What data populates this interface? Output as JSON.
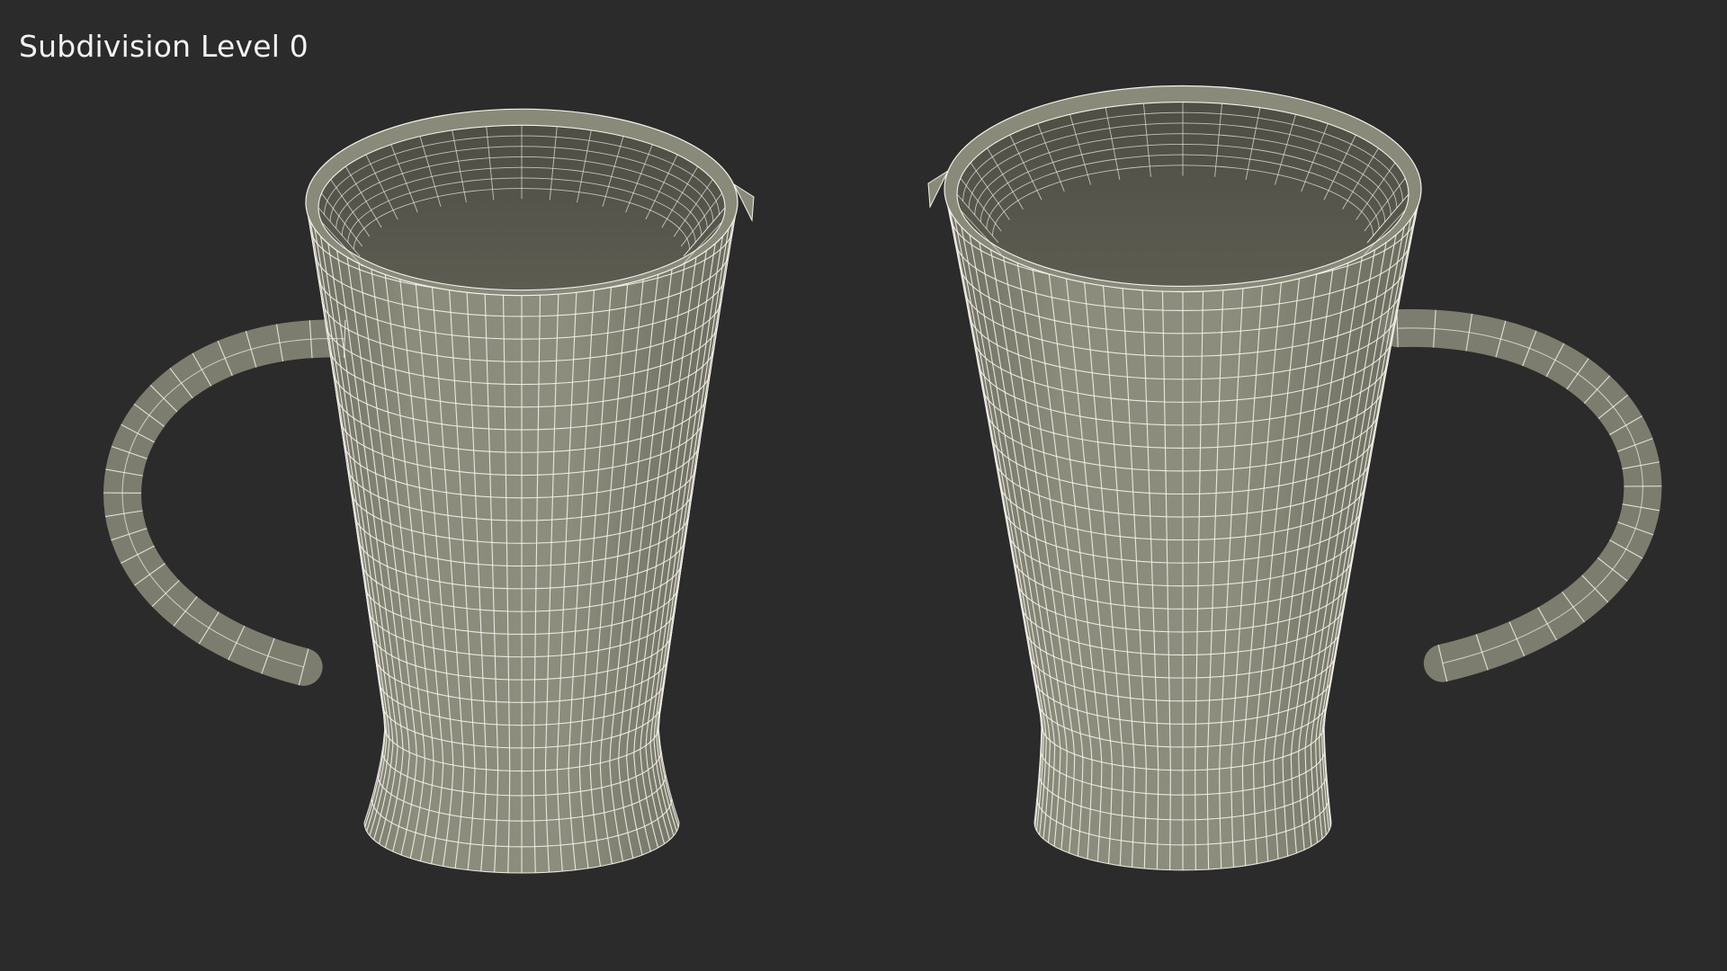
{
  "overlay": {
    "subdivision_label": "Subdivision Level 0"
  },
  "scene": {
    "background_color": "#2b2b2b",
    "model_color": "#8a8a7a",
    "wire_color": "#f4f2ea",
    "views": [
      {
        "name": "mug-view-handle-left"
      },
      {
        "name": "mug-view-handle-right"
      }
    ]
  }
}
